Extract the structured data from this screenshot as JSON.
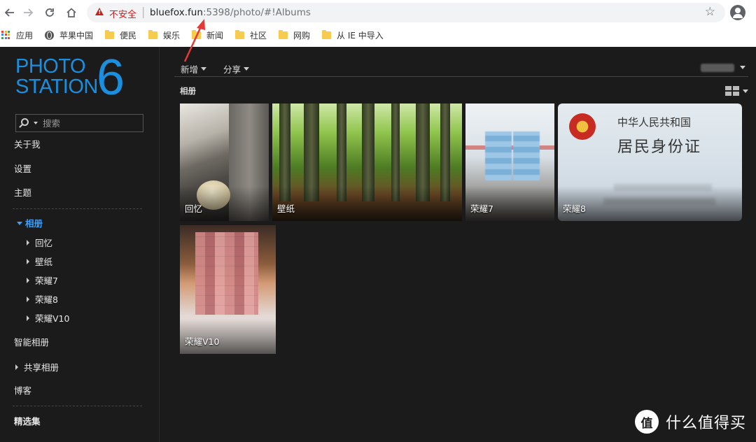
{
  "browser": {
    "security_label": "不安全",
    "url_host": "bluefox.fun",
    "url_rest": ":5398/photo/#!Albums",
    "bookmarks": [
      "应用",
      "苹果中国",
      "便民",
      "娱乐",
      "新闻",
      "社区",
      "网购",
      "从 IE 中导入"
    ]
  },
  "logo": {
    "line1": "PHOTO",
    "line2": "STATION",
    "number": "6"
  },
  "sidebar": {
    "search_placeholder": "搜索",
    "about": "关于我",
    "settings": "设置",
    "theme": "主题",
    "albums": "相册",
    "album_items": [
      "回忆",
      "壁纸",
      "荣耀7",
      "荣耀8",
      "荣耀V10"
    ],
    "smart_albums": "智能相册",
    "shared_albums": "共享相册",
    "blog": "博客",
    "featured": "精选集"
  },
  "toolbar": {
    "new_label": "新增",
    "share_label": "分享"
  },
  "main": {
    "section_title": "相册",
    "albums": [
      {
        "label": "回忆"
      },
      {
        "label": "壁纸"
      },
      {
        "label": "荣耀7"
      },
      {
        "label": "荣耀8"
      },
      {
        "label": "荣耀V10"
      }
    ]
  },
  "id_card": {
    "title": "中华人民共和国",
    "subtitle": "居民身份证"
  },
  "watermark": {
    "text": "什么值得买",
    "logo": "值"
  },
  "colors": {
    "accent": "#1a8fe0",
    "active": "#3aa0ff",
    "background": "#1b1b1b",
    "insecure": "#c5221f"
  }
}
